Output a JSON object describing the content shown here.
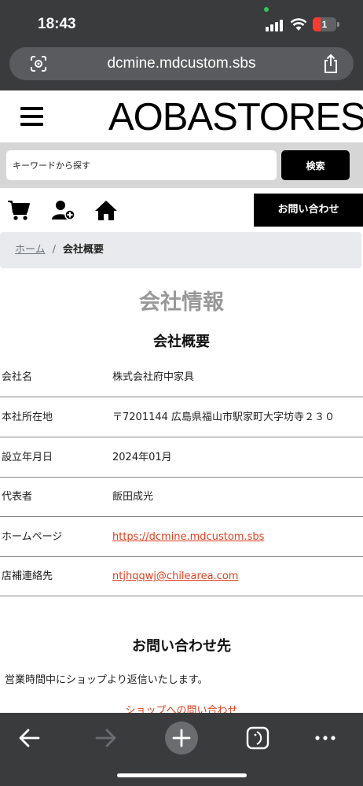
{
  "status_bar": {
    "time": "18:43",
    "battery": "1"
  },
  "browser": {
    "url": "dcmine.mdcustom.sbs"
  },
  "header": {
    "logo": "AOBASTORES"
  },
  "search": {
    "placeholder": "キーワードから探す",
    "button_label": "検索"
  },
  "nav": {
    "contact_label": "お問い合わせ",
    "icons": [
      "cart-icon",
      "add-user-icon",
      "home-icon"
    ]
  },
  "breadcrumb": {
    "home": "ホーム",
    "separator": "/",
    "current": "会社概要"
  },
  "page": {
    "title": "会社情報",
    "subtitle": "会社概要",
    "rows": [
      {
        "label": "会社名",
        "value": "株式会社府中家具"
      },
      {
        "label": "本社所在地",
        "value": "〒7201144 広島県福山市駅家町大字坊寺２３０"
      },
      {
        "label": "設立年月日",
        "value": "2024年01月"
      },
      {
        "label": "代表者",
        "value": "飯田成光"
      },
      {
        "label": "ホームページ",
        "value": "https://dcmine.mdcustom.sbs"
      },
      {
        "label": "店補連絡先",
        "value": "ntjhqqwj@chilearea.com"
      }
    ],
    "inquiry_title": "お問い合わせ先",
    "hours_text": "営業時間中にショップより返信いたします。",
    "shop_contact_link": "ショップへの問い合わせ"
  },
  "colors": {
    "browser_chrome": "#3a3b3d",
    "link": "#e04020",
    "title_gray": "#999999",
    "breadcrumb_bg": "#e8eaed"
  }
}
